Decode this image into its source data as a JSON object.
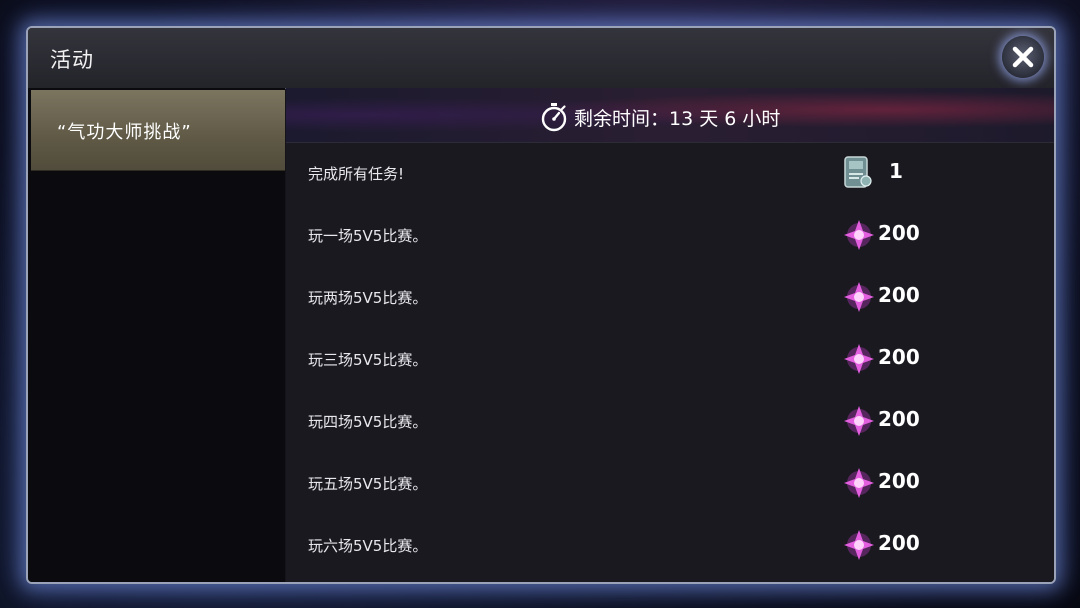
{
  "window": {
    "title": "活动",
    "close_icon": "close-icon"
  },
  "sidebar": {
    "items": [
      {
        "label": "“气功大师挑战”",
        "selected": true
      }
    ]
  },
  "banner": {
    "timer_icon": "stopwatch-icon",
    "remaining": "剩余时间：13 天 6 小时"
  },
  "tasks": [
    {
      "text": "完成所有任务!",
      "reward": "1",
      "reward_icon": "scroll-token-icon"
    },
    {
      "text": "玩一场5V5比赛。",
      "reward": "200",
      "reward_icon": "purple-crystal-icon"
    },
    {
      "text": "玩两场5V5比赛。",
      "reward": "200",
      "reward_icon": "purple-crystal-icon"
    },
    {
      "text": "玩三场5V5比赛。",
      "reward": "200",
      "reward_icon": "purple-crystal-icon"
    },
    {
      "text": "玩四场5V5比赛。",
      "reward": "200",
      "reward_icon": "purple-crystal-icon"
    },
    {
      "text": "玩五场5V5比赛。",
      "reward": "200",
      "reward_icon": "purple-crystal-icon"
    },
    {
      "text": "玩六场5V5比赛。",
      "reward": "200",
      "reward_icon": "purple-crystal-icon"
    }
  ],
  "colors": {
    "window_glow": "#7896e6",
    "selected_tab": "#6b6552",
    "crystal": "#d24ad6"
  }
}
